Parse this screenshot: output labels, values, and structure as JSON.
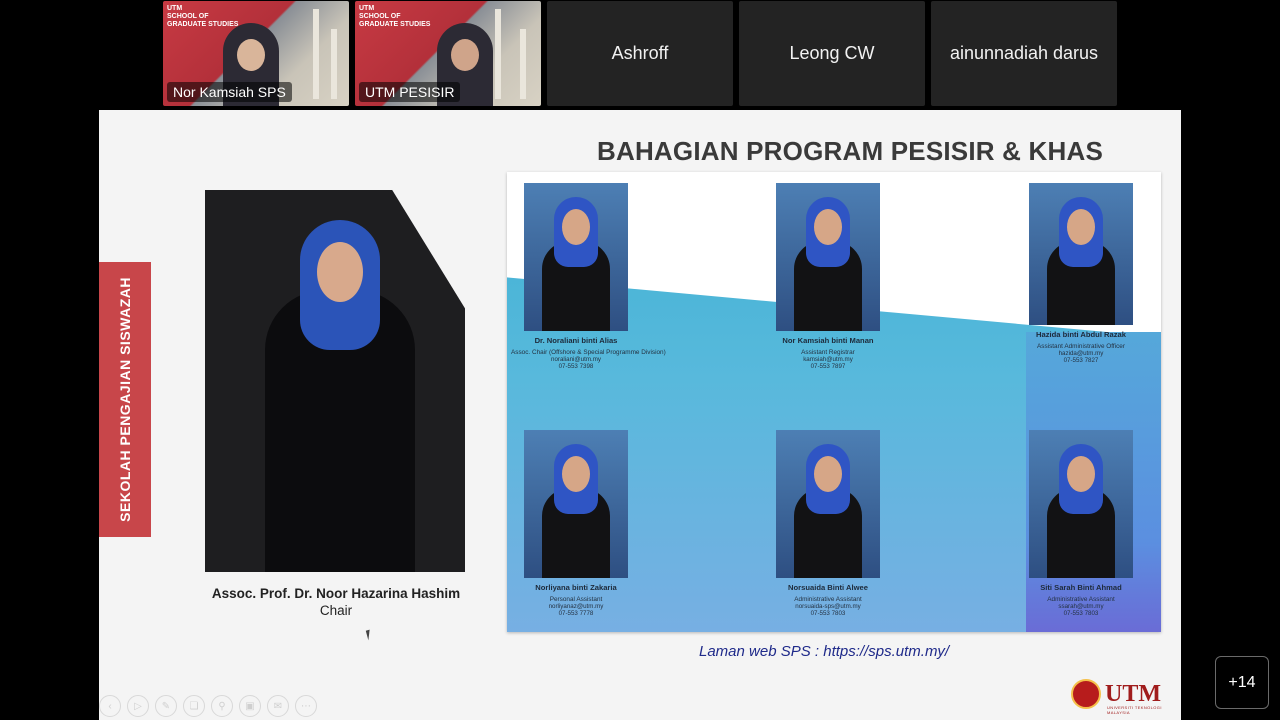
{
  "participants": {
    "video": [
      {
        "label": "Nor Kamsiah SPS",
        "brand": "UTM\nSCHOOL OF\nGRADUATE STUDIES"
      },
      {
        "label": "UTM PESISIR",
        "brand": "UTM\nSCHOOL OF\nGRADUATE STUDIES"
      }
    ],
    "named": [
      "Ashroff",
      "Leong CW",
      "ainunnadiah darus"
    ],
    "more_count": "+14"
  },
  "slide": {
    "sidebar_text": "SEKOLAH PENGAJIAN SISWAZAH",
    "title": "BAHAGIAN PROGRAM PESISIR & KHAS",
    "chair": {
      "name": "Assoc. Prof. Dr. Noor Hazarina Hashim",
      "role": "Chair"
    },
    "staff": [
      {
        "name": "Dr. Noraliani binti Alias",
        "role": "Assoc. Chair (Offshore & Special Programme Division)",
        "email": "noraliani@utm.my",
        "phone": "07-553 7398"
      },
      {
        "name": "Nor Kamsiah binti Manan",
        "role": "Assistant Registrar",
        "email": "kamsiah@utm.my",
        "phone": "07-553 7897"
      },
      {
        "name": "Hazida binti Abdul Razak",
        "role": "Assistant Administrative Officer",
        "email": "hazida@utm.my",
        "phone": "07-553 7827"
      },
      {
        "name": "Norliyana binti Zakaria",
        "role": "Personal Assistant",
        "email": "norliyanaz@utm.my",
        "phone": "07-553 7778"
      },
      {
        "name": "Norsuaida Binti Alwee",
        "role": "Administrative Assistant",
        "email": "norsuaida-sps@utm.my",
        "phone": "07-553 7803"
      },
      {
        "name": "Siti Sarah Binti Ahmad",
        "role": "Administrative Assistant",
        "email": "ssarah@utm.my",
        "phone": "07-553 7803"
      }
    ],
    "weblink": "Laman web SPS : https://sps.utm.my/",
    "logo": {
      "text": "UTM",
      "sub": "UNIVERSITI TEKNOLOGI MALAYSIA"
    }
  },
  "toolbar_icons": [
    "prev-icon",
    "play-icon",
    "pen-icon",
    "copy-icon",
    "zoom-icon",
    "screen-icon",
    "mail-icon",
    "more-icon"
  ]
}
